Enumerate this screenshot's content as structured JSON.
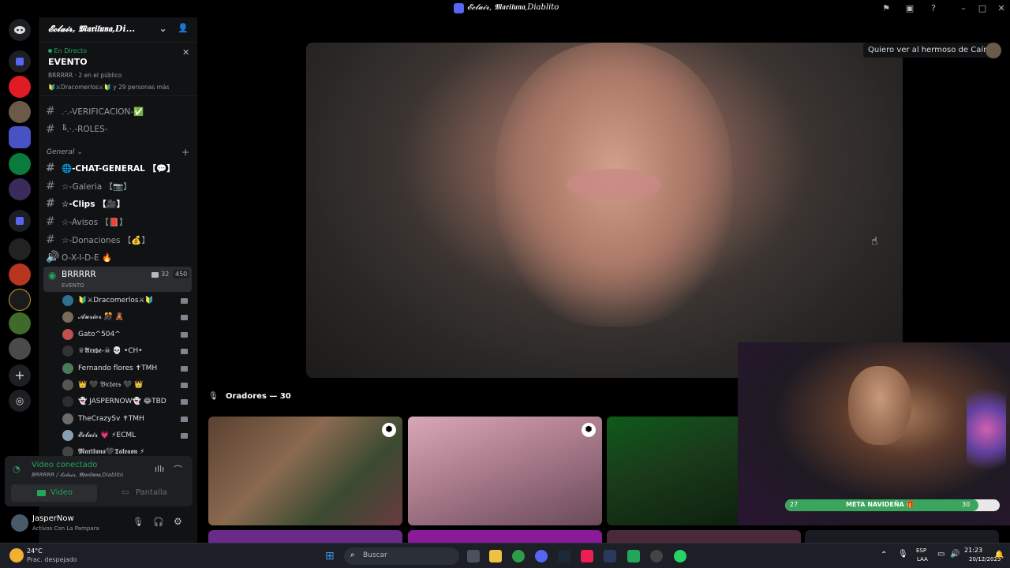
{
  "window": {
    "title": "𝓔𝓬𝓵𝓪𝓲𝓻, 𝕸𝖆𝖗𝖎𝖑𝖚𝖓𝖆,Diablito"
  },
  "server": {
    "name": "𝓔𝓬𝓵𝓪𝓲𝓻, 𝕸𝖆𝖗𝖎𝖑𝖚𝖓𝖆,Di..."
  },
  "event": {
    "live_label": "En Directo",
    "title": "EVENTO",
    "host": "BRRRRR",
    "public_count": "2 en el público",
    "people": "🔰⚔Dracomerlos⚔🔰 y 29 personas más"
  },
  "channels_top": [
    {
      "name": ".·.-VERIFICACION-✅"
    },
    {
      "name": "╚.·.-ROLES-"
    }
  ],
  "category": {
    "name": "General"
  },
  "channels": [
    {
      "name": "🌐-CHAT-GENERAL 【💬】"
    },
    {
      "name": "☆-Galeria 【📷】"
    },
    {
      "name": "☆-Clips 【🎥】"
    },
    {
      "name": "☆-Avisos 【📕】"
    },
    {
      "name": "☆-Donaciones 【💰】"
    },
    {
      "name": "O-X-I-D-E 🔥"
    }
  ],
  "voice_channel": {
    "name": "BRRRRR",
    "sub": "EVENTO",
    "video_count": "32",
    "listeners": "450"
  },
  "members": [
    {
      "name": "🔰⚔Dracomerlos⚔🔰"
    },
    {
      "name": "𝓐𝓾𝓻𝓲𝓸𝓻 🎊 🧸"
    },
    {
      "name": "Gato^504^"
    },
    {
      "name": "♕𝕬𝖗𝖝𝖇𝖊-☠ 💀 •CH•"
    },
    {
      "name": "Fernando flores ✝TMH"
    },
    {
      "name": "👑 🖤 𝔅𝔦𝔠𝔥𝔬𝔯𝔰 🖤 👑"
    },
    {
      "name": "👻 JASPERNOW👻 😂TBD"
    },
    {
      "name": "TheCrazySv ✝TMH"
    },
    {
      "name": "𝓔𝓬𝓵𝓪𝓲𝓻 💗 ⚡ECML"
    },
    {
      "name": "𝕸𝖆𝖗𝖎𝖑𝖚𝖓𝖆🖤𝕿𝖆𝖑𝖊𝖆𝖔𝖓 ⚡"
    }
  ],
  "voice_panel": {
    "status": "Video conectado",
    "location": "BRRRRR / 𝓔𝓬𝓵𝓪𝓲𝓻, 𝕸𝖆𝖗𝖎𝖑𝖚𝖓𝖆,Diablito",
    "video_btn": "Video",
    "screen_btn": "Pantalla"
  },
  "user": {
    "name": "JasperNow",
    "status": "Activos Con La Pampara"
  },
  "stage": {
    "speakers_label": "Oradores — 30",
    "tooltip": "Quiero ver al hermoso de Caín"
  },
  "overlay": {
    "goal_label": "META NAVIDEÑA 🎁",
    "goal_left": "27",
    "goal_right": "30",
    "goal_progress": 0.9
  },
  "taskbar": {
    "weather_temp": "24°C",
    "weather_desc": "Prac. despejado",
    "search_placeholder": "Buscar",
    "lang_top": "ESP",
    "lang_bottom": "LAA",
    "time": "21:23",
    "date": "20/12/2025"
  },
  "colors": {
    "accent": "#5865f2",
    "live": "#23a55a",
    "goal": "#3ba55d"
  }
}
